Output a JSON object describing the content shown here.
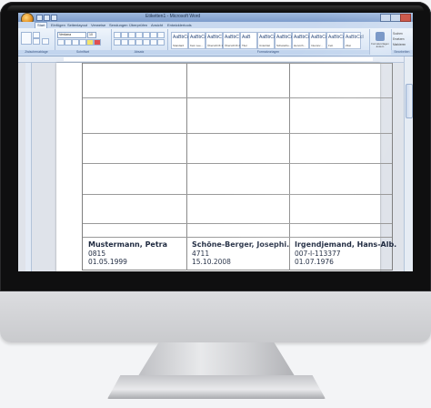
{
  "window": {
    "title": "Etiketten1 - Microsoft Word"
  },
  "ribbon": {
    "tabs": [
      "Start",
      "Einfügen",
      "Seitenlayout",
      "Verweise",
      "Sendungen",
      "Überprüfen",
      "Ansicht",
      "Entwicklertools"
    ],
    "groups": [
      "Zwischenablage",
      "Schriftart",
      "Absatz",
      "Formatvorlagen",
      "Bearbeiten"
    ],
    "font_name": "Verdana",
    "font_size": "10",
    "styles": [
      {
        "sample": "AaBbCcI",
        "name": "Standard"
      },
      {
        "sample": "AaBbCcI",
        "name": "Kein Lee..."
      },
      {
        "sample": "AaBbC",
        "name": "Überschrift 1"
      },
      {
        "sample": "AaBbC",
        "name": "Überschrift 2"
      },
      {
        "sample": "AaB",
        "name": "Titel"
      },
      {
        "sample": "AaBbCcI",
        "name": "Untertitel"
      },
      {
        "sample": "AaBbCcI",
        "name": "Schwache..."
      },
      {
        "sample": "AaBbCcI",
        "name": "Hervorh..."
      },
      {
        "sample": "AaBbCcI",
        "name": "Intensiv..."
      },
      {
        "sample": "AaBbCcI",
        "name": "Fett"
      },
      {
        "sample": "AaBbCcI",
        "name": "Zitat"
      }
    ],
    "change_styles_label": "Formatvorlagen ändern",
    "edit_items": [
      "Suchen",
      "Ersetzen",
      "Markieren"
    ]
  },
  "labels": [
    {
      "name": "Mustermann, Petra",
      "id": "0815",
      "date": "01.05.1999"
    },
    {
      "name": "Schöne-Berger, Josephi.",
      "id": "4711",
      "date": "15.10.2008"
    },
    {
      "name": "Irgendjemand, Hans-Alb.",
      "id": "007-I-113377",
      "date": "01.07.1976"
    }
  ],
  "colors": {
    "ribbon_bg": "#d3e1f3",
    "title_bar": "#7d9ccb",
    "monitor_bezel": "#0f0f10",
    "label_text": "#1f2a40"
  }
}
